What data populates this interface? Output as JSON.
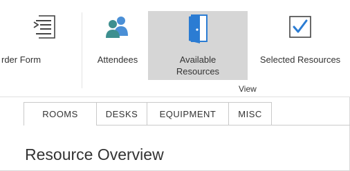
{
  "ribbon": {
    "buttons": {
      "order_form": {
        "label": "rder Form",
        "icon": "order-form-icon"
      },
      "attendees": {
        "label": "Attendees",
        "icon": "attendees-icon"
      },
      "available_resources": {
        "label": "Available Resources",
        "icon": "door-icon"
      },
      "selected_resources": {
        "label": "Selected Resources",
        "icon": "checkbox-checked-icon"
      }
    },
    "group_label": "View"
  },
  "tabs": [
    {
      "label": "ROOMS"
    },
    {
      "label": "DESKS"
    },
    {
      "label": "EQUIPMENT"
    },
    {
      "label": "MISC"
    }
  ],
  "page": {
    "title": "Resource Overview"
  },
  "colors": {
    "accent": "#2b7cd3",
    "attendees_teal": "#3d8f8f",
    "attendees_blue": "#4a8fd6",
    "selected_bg": "#d6d6d6"
  }
}
